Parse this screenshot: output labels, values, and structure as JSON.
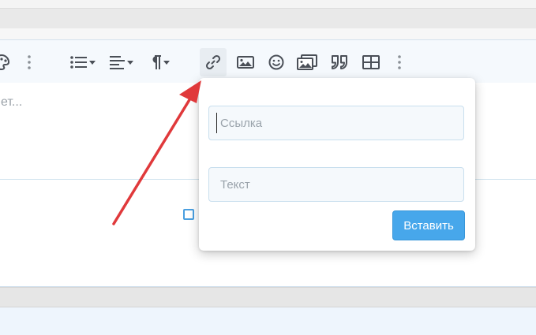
{
  "editor": {
    "placeholder_fragment": "ет...",
    "toolbar": {
      "icons": [
        "palette-icon",
        "more-vertical-icon",
        "list-icon",
        "align-icon",
        "paragraph-icon",
        "link-icon",
        "image-icon",
        "smiley-icon",
        "media-gallery-icon",
        "quote-icon",
        "table-icon",
        "more-vertical-icon"
      ]
    }
  },
  "link_popup": {
    "url_placeholder": "Ссылка",
    "text_placeholder": "Текст",
    "insert_label": "Вставить"
  },
  "colors": {
    "accent": "#47a7eb",
    "annotation_arrow": "#e0393b"
  }
}
